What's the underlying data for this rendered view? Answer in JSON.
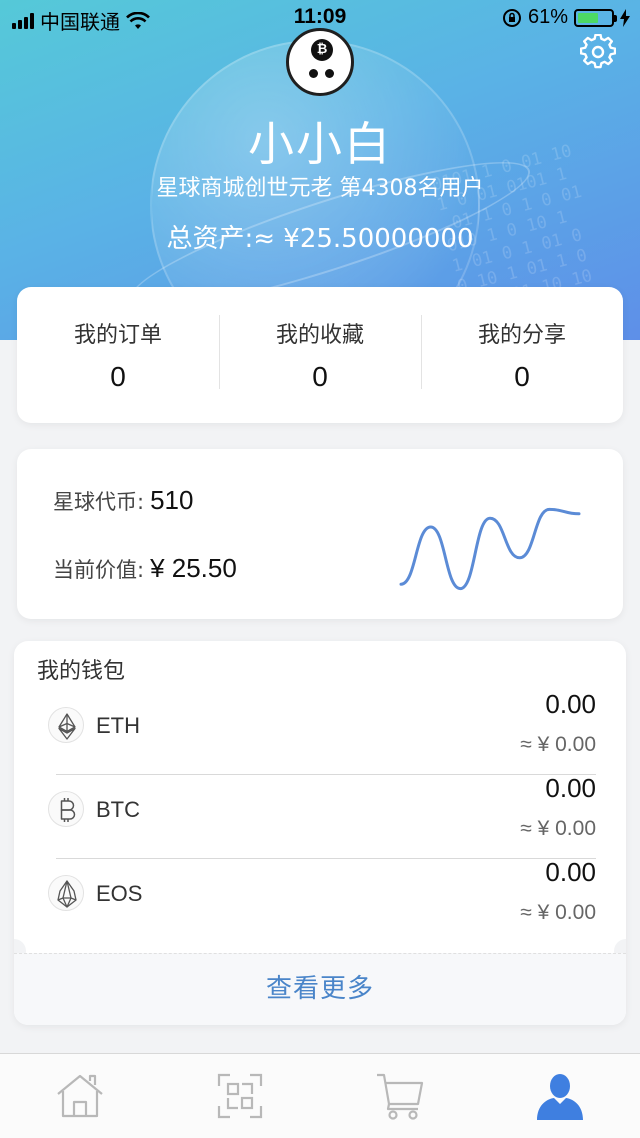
{
  "status_bar": {
    "carrier": "中国联通",
    "time": "11:09",
    "battery_percent": "61%",
    "battery_level": 0.61
  },
  "profile": {
    "name": "小小白",
    "subtitle": "星球商城创世元老 第4308名用户",
    "total_assets": "总资产:≈ ¥25.50000000",
    "avatar_icon": "bitcoin-bubble-avatar",
    "settings_icon": "gear-icon"
  },
  "stats": [
    {
      "label": "我的订单",
      "value": "0"
    },
    {
      "label": "我的收藏",
      "value": "0"
    },
    {
      "label": "我的分享",
      "value": "0"
    }
  ],
  "coin": {
    "token_label": "星球代币:",
    "token_value": "510",
    "price_label": "当前价值:",
    "price_value": "¥ 25.50",
    "sparkline": [
      0.1,
      0.75,
      0.05,
      0.85,
      0.4,
      0.95,
      0.9
    ],
    "accent_color": "#3b7be3"
  },
  "wallet": {
    "title": "我的钱包",
    "items": [
      {
        "symbol": "ETH",
        "amount": "0.00",
        "fiat": "≈ ¥ 0.00",
        "icon": "ethereum-icon"
      },
      {
        "symbol": "BTC",
        "amount": "0.00",
        "fiat": "≈ ¥ 0.00",
        "icon": "bitcoin-icon"
      },
      {
        "symbol": "EOS",
        "amount": "0.00",
        "fiat": "≈ ¥ 0.00",
        "icon": "eos-icon"
      }
    ],
    "view_more": "查看更多"
  },
  "tabs": [
    {
      "icon": "home-icon",
      "active": false
    },
    {
      "icon": "scan-icon",
      "active": false
    },
    {
      "icon": "cart-icon",
      "active": false
    },
    {
      "icon": "profile-icon",
      "active": true
    }
  ],
  "colors": {
    "link": "#4a85c9",
    "active_tab": "#3f7fe0",
    "inactive_tab": "#b8b8b8"
  }
}
